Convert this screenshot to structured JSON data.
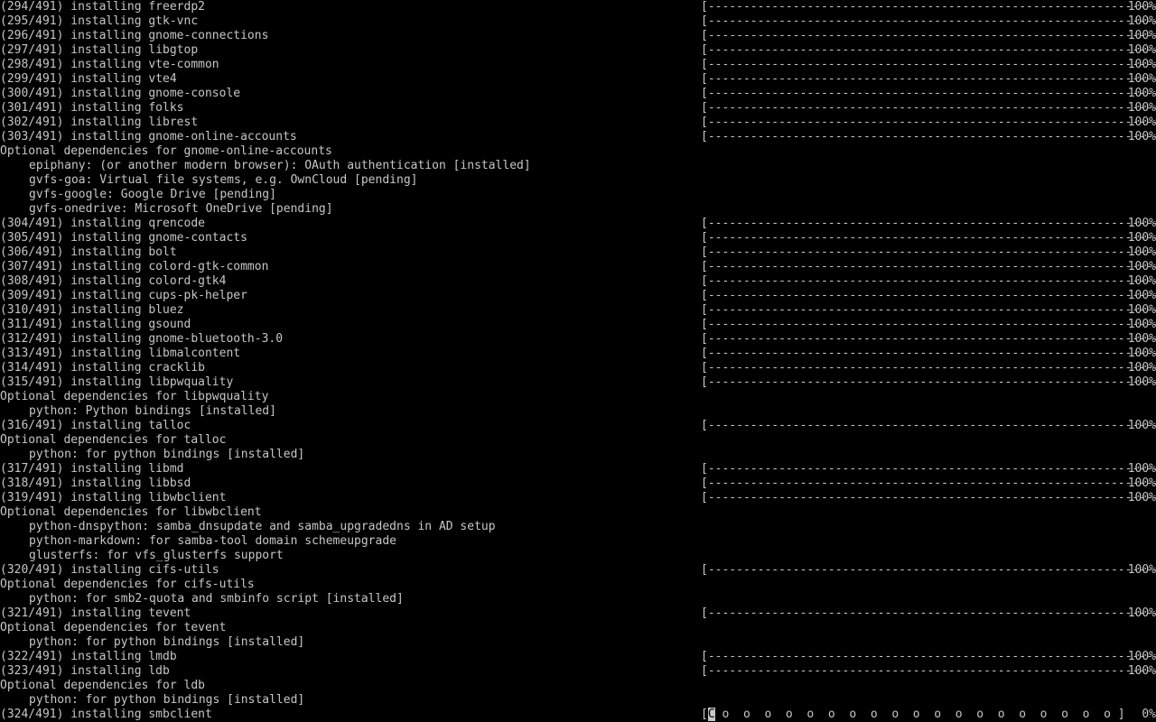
{
  "terminal": {
    "colors": {
      "background": "#000000",
      "foreground": "#c6c6c6"
    },
    "lines": [
      {
        "kind": "install",
        "text": "(294/491) installing freerdp2",
        "percent": "100%"
      },
      {
        "kind": "install",
        "text": "(295/491) installing gtk-vnc",
        "percent": "100%"
      },
      {
        "kind": "install",
        "text": "(296/491) installing gnome-connections",
        "percent": "100%"
      },
      {
        "kind": "install",
        "text": "(297/491) installing libgtop",
        "percent": "100%"
      },
      {
        "kind": "install",
        "text": "(298/491) installing vte-common",
        "percent": "100%"
      },
      {
        "kind": "install",
        "text": "(299/491) installing vte4",
        "percent": "100%"
      },
      {
        "kind": "install",
        "text": "(300/491) installing gnome-console",
        "percent": "100%"
      },
      {
        "kind": "install",
        "text": "(301/491) installing folks",
        "percent": "100%"
      },
      {
        "kind": "install",
        "text": "(302/491) installing librest",
        "percent": "100%"
      },
      {
        "kind": "install",
        "text": "(303/491) installing gnome-online-accounts",
        "percent": "100%"
      },
      {
        "kind": "header",
        "text": "Optional dependencies for gnome-online-accounts"
      },
      {
        "kind": "dep",
        "text": "epiphany: (or another modern browser): OAuth authentication [installed]"
      },
      {
        "kind": "dep",
        "text": "gvfs-goa: Virtual file systems, e.g. OwnCloud [pending]"
      },
      {
        "kind": "dep",
        "text": "gvfs-google: Google Drive [pending]"
      },
      {
        "kind": "dep",
        "text": "gvfs-onedrive: Microsoft OneDrive [pending]"
      },
      {
        "kind": "install",
        "text": "(304/491) installing qrencode",
        "percent": "100%"
      },
      {
        "kind": "install",
        "text": "(305/491) installing gnome-contacts",
        "percent": "100%"
      },
      {
        "kind": "install",
        "text": "(306/491) installing bolt",
        "percent": "100%"
      },
      {
        "kind": "install",
        "text": "(307/491) installing colord-gtk-common",
        "percent": "100%"
      },
      {
        "kind": "install",
        "text": "(308/491) installing colord-gtk4",
        "percent": "100%"
      },
      {
        "kind": "install",
        "text": "(309/491) installing cups-pk-helper",
        "percent": "100%"
      },
      {
        "kind": "install",
        "text": "(310/491) installing bluez",
        "percent": "100%"
      },
      {
        "kind": "install",
        "text": "(311/491) installing gsound",
        "percent": "100%"
      },
      {
        "kind": "install",
        "text": "(312/491) installing gnome-bluetooth-3.0",
        "percent": "100%"
      },
      {
        "kind": "install",
        "text": "(313/491) installing libmalcontent",
        "percent": "100%"
      },
      {
        "kind": "install",
        "text": "(314/491) installing cracklib",
        "percent": "100%"
      },
      {
        "kind": "install",
        "text": "(315/491) installing libpwquality",
        "percent": "100%"
      },
      {
        "kind": "header",
        "text": "Optional dependencies for libpwquality"
      },
      {
        "kind": "dep",
        "text": "python: Python bindings [installed]"
      },
      {
        "kind": "install",
        "text": "(316/491) installing talloc",
        "percent": "100%"
      },
      {
        "kind": "header",
        "text": "Optional dependencies for talloc"
      },
      {
        "kind": "dep",
        "text": "python: for python bindings [installed]"
      },
      {
        "kind": "install",
        "text": "(317/491) installing libmd",
        "percent": "100%"
      },
      {
        "kind": "install",
        "text": "(318/491) installing libbsd",
        "percent": "100%"
      },
      {
        "kind": "install",
        "text": "(319/491) installing libwbclient",
        "percent": "100%"
      },
      {
        "kind": "header",
        "text": "Optional dependencies for libwbclient"
      },
      {
        "kind": "dep",
        "text": "python-dnspython: samba_dnsupdate and samba_upgradedns in AD setup"
      },
      {
        "kind": "dep",
        "text": "python-markdown: for samba-tool domain schemeupgrade"
      },
      {
        "kind": "dep",
        "text": "glusterfs: for vfs_glusterfs support"
      },
      {
        "kind": "install",
        "text": "(320/491) installing cifs-utils",
        "percent": "100%"
      },
      {
        "kind": "header",
        "text": "Optional dependencies for cifs-utils"
      },
      {
        "kind": "dep",
        "text": "python: for smb2-quota and smbinfo script [installed]"
      },
      {
        "kind": "install",
        "text": "(321/491) installing tevent",
        "percent": "100%"
      },
      {
        "kind": "header",
        "text": "Optional dependencies for tevent"
      },
      {
        "kind": "dep",
        "text": "python: for python bindings [installed]"
      },
      {
        "kind": "install",
        "text": "(322/491) installing lmdb",
        "percent": "100%"
      },
      {
        "kind": "install",
        "text": "(323/491) installing ldb",
        "percent": "100%"
      },
      {
        "kind": "header",
        "text": "Optional dependencies for ldb"
      },
      {
        "kind": "dep",
        "text": "python: for python bindings [installed]"
      },
      {
        "kind": "current",
        "text": "(324/491) installing smbclient",
        "percent": "0%"
      }
    ],
    "progress_bar_full": "[-----------------------------------------------------------------------------]",
    "progress_bar_current_open": "[",
    "progress_bar_current_cursor": "C",
    "progress_bar_current_rest": " o  o  o  o  o  o  o  o  o  o  o  o  o  o  o  o  o  o  o ]"
  }
}
